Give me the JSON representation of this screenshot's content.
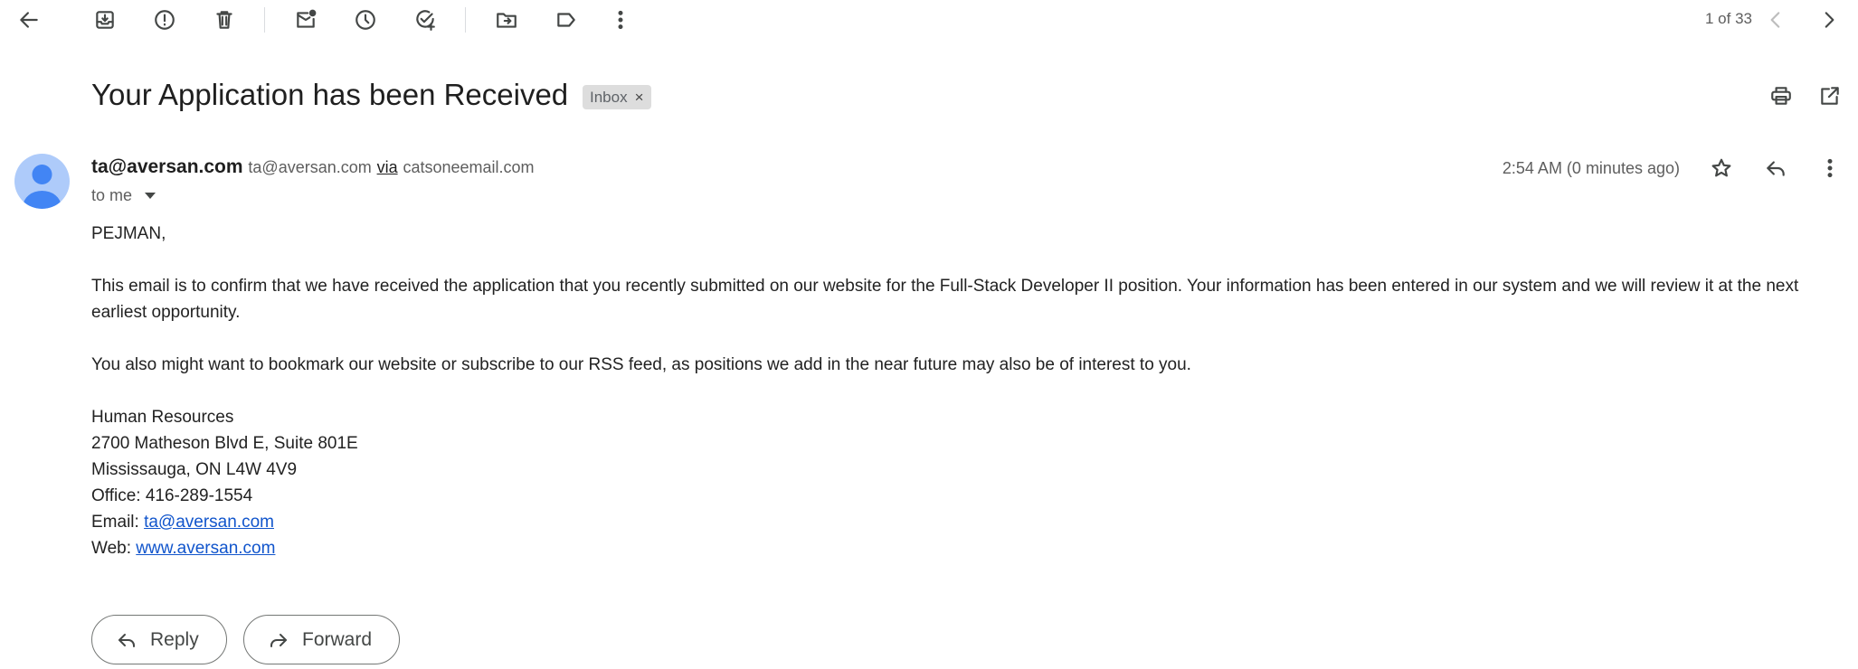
{
  "toolbar": {
    "back_icon": "arrow-left-icon",
    "archive_icon": "archive-icon",
    "spam_icon": "report-spam-icon",
    "delete_icon": "trash-icon",
    "mark_unread_icon": "mark-unread-icon",
    "snooze_icon": "clock-icon",
    "add_task_icon": "add-task-icon",
    "move_icon": "move-to-icon",
    "label_icon": "label-icon",
    "more_icon": "more-vert-icon",
    "pager_text": "1 of 33",
    "prev_icon": "chevron-left-icon",
    "next_icon": "chevron-right-icon"
  },
  "subject": {
    "title": "Your Application has been Received",
    "label": "Inbox",
    "label_remove": "×",
    "print_icon": "print-icon",
    "open_new_window_icon": "open-in-new-icon"
  },
  "message": {
    "sender_name": "ta@aversan.com",
    "sender_email": "ta@aversan.com",
    "via_text": "via",
    "via_domain": "catsoneemail.com",
    "to_text": "to me",
    "timestamp": "2:54 AM (0 minutes ago)",
    "star_icon": "star-icon",
    "reply_icon": "reply-icon",
    "more_icon": "more-vert-icon"
  },
  "body": {
    "greeting": "PEJMAN,",
    "paragraph1": "This email is to confirm that we have received the application that you recently submitted on our website for the Full-Stack Developer II position. Your information has been entered in our system and we will review it at the next earliest opportunity.",
    "paragraph2": "You also might want to bookmark our website or subscribe to our RSS feed, as positions we add in the near future may also be of interest to you.",
    "signature": {
      "department": "Human Resources",
      "address1": "2700 Matheson Blvd E, Suite 801E",
      "address2": "Mississauga, ON L4W 4V9",
      "office": "Office: 416-289-1554",
      "email_label": "Email: ",
      "email_link": "ta@aversan.com",
      "web_label": "Web: ",
      "web_link": "www.aversan.com"
    }
  },
  "actions": {
    "reply_label": "Reply",
    "forward_label": "Forward"
  }
}
